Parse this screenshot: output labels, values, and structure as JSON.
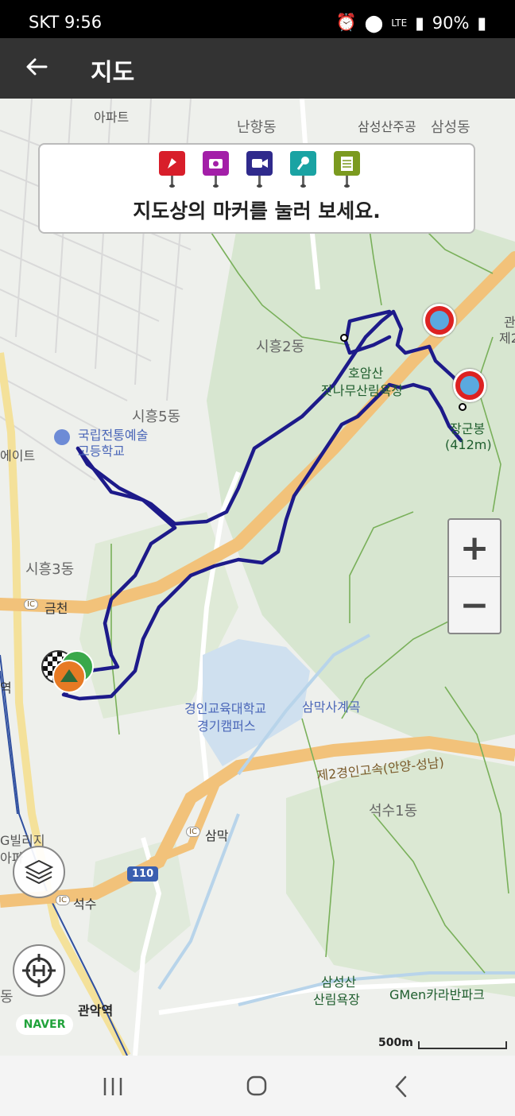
{
  "status": {
    "carrier_time": "SKT 9:56",
    "network": "LTE",
    "battery": "90%"
  },
  "appbar": {
    "title": "지도"
  },
  "hint": {
    "text": "지도상의 마커를 눌러 보세요.",
    "marker_colors": [
      "#d81e2a",
      "#a31fa8",
      "#2f2a8c",
      "#1aa3a3",
      "#7b9a1f"
    ],
    "marker_icons": [
      "flag-icon",
      "camera-icon",
      "video-icon",
      "microphone-icon",
      "memo-icon"
    ]
  },
  "map": {
    "labels": {
      "apt_top": "아파트",
      "nanhyang": "난향동",
      "samsung_apt": "삼성산주공",
      "samsung_apt2": "아파트",
      "samsungdong": "삼성동",
      "siheung2": "시흥2동",
      "homsan": "호암산",
      "jatnamu": "잣나무산림욕장",
      "jangkunbong": "장군봉",
      "jangkun_height": "(412m)",
      "siheung5": "시흥5동",
      "school1": "국립전통예술",
      "school2": "고등학교",
      "eight": "에이트",
      "siheung3": "시흥3동",
      "geumcheon": "금천",
      "station_left": "역",
      "univ1": "경인교육대학교",
      "univ2": "경기캠퍼스",
      "sammak_valley": "삼막사계곡",
      "highway": "제2경인고속(안양-성남)",
      "seoksu1": "석수1동",
      "sammak": "삼막",
      "route110": "110",
      "villa": "G빌리지",
      "villa_apt": "아파",
      "seoksu": "석수",
      "gwanak_station": "관악역",
      "samsungsan1": "삼성산",
      "samsungsan2": "산림욕장",
      "gmen": "GMen카라반파크",
      "dong_left": "동",
      "right_edge1": "관",
      "right_edge2": "제2"
    },
    "ic": "IC",
    "naver": "NAVER",
    "scale": "500m",
    "route_color": "#1d1a8a",
    "highway_color": "#f2c27a"
  }
}
